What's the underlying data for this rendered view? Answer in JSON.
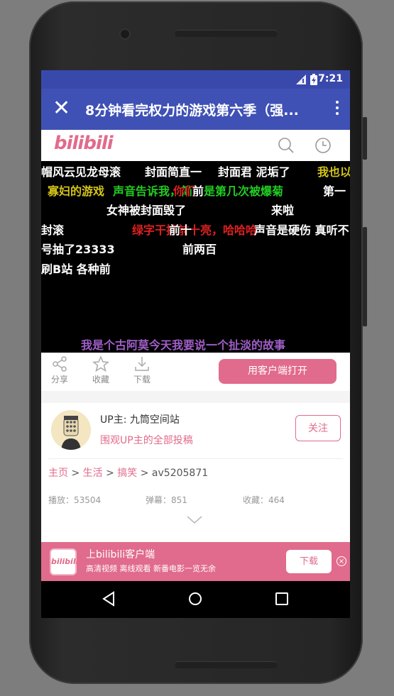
{
  "statusbar": {
    "time": "7:21",
    "signal_icon": "cell-signal-icon",
    "battery_icon": "battery-icon"
  },
  "appbar": {
    "title": "8分钟看完权力的游戏第六季（强...",
    "close_icon": "close-icon",
    "more_icon": "more-vert-icon"
  },
  "site": {
    "logo": "bilibili"
  },
  "danmaku": [
    {
      "text": "帽风云见龙母滚",
      "color": "#ffffff"
    },
    {
      "text": "封面简直一",
      "color": "#ffffff"
    },
    {
      "text": "封面君 泥垢了",
      "color": "#ffffff"
    },
    {
      "text": "我也以",
      "color": "#d4c41a"
    },
    {
      "text": "寡妇的游戏",
      "color": "#d4c41a"
    },
    {
      "text": "声音告诉我，简",
      "color": "#22cc22"
    },
    {
      "text": "你们",
      "color": "#e02020"
    },
    {
      "text": "前",
      "color": "#ffffff"
    },
    {
      "text": "是第几次被爆菊",
      "color": "#22cc22"
    },
    {
      "text": "第一",
      "color": "#ffffff"
    },
    {
      "text": "女神被封面毁了",
      "color": "#ffffff"
    },
    {
      "text": "来啦",
      "color": "#ffffff"
    },
    {
      "text": "封滚",
      "color": "#ffffff"
    },
    {
      "text": "绿字干掉前十",
      "color": "#e02020"
    },
    {
      "text": "前十",
      "color": "#ffffff"
    },
    {
      "text": "亮，哈哈哈",
      "color": "#e02020"
    },
    {
      "text": "声音是硬伤 真听不",
      "color": "#ffffff"
    },
    {
      "text": "号抽了23333",
      "color": "#ffffff"
    },
    {
      "text": "前两百",
      "color": "#ffffff"
    },
    {
      "text": "刷B站 各种前",
      "color": "#ffffff"
    },
    {
      "text": "我是个古阿莫今天我要说一个扯淡的故事",
      "color": "#a05ec8"
    }
  ],
  "actions": {
    "share": "分享",
    "favorite": "收藏",
    "download": "下载",
    "open_app": "用客户端打开"
  },
  "uploader": {
    "name": "UP主: 九筒空间站",
    "all_posts": "围观UP主的全部投稿",
    "follow": "关注"
  },
  "breadcrumb": {
    "home": "主页",
    "sep1": " > ",
    "cat": "生活",
    "sep2": " > ",
    "sub": "搞笑",
    "sep3": " > ",
    "av": "av5205871"
  },
  "stats": {
    "plays": "播放：53504",
    "danmaku": "弹幕：851",
    "favorites": "收藏：464"
  },
  "promo": {
    "icon_text": "bilibili",
    "title": "上bilibili客户端",
    "subtitle": "高清视频 离线观看 新番电影一览无余",
    "download": "下载",
    "close": "×"
  },
  "colors": {
    "primary": "#3f51b5",
    "statusbar": "#3949ab",
    "accent_pink": "#e16b8c"
  }
}
